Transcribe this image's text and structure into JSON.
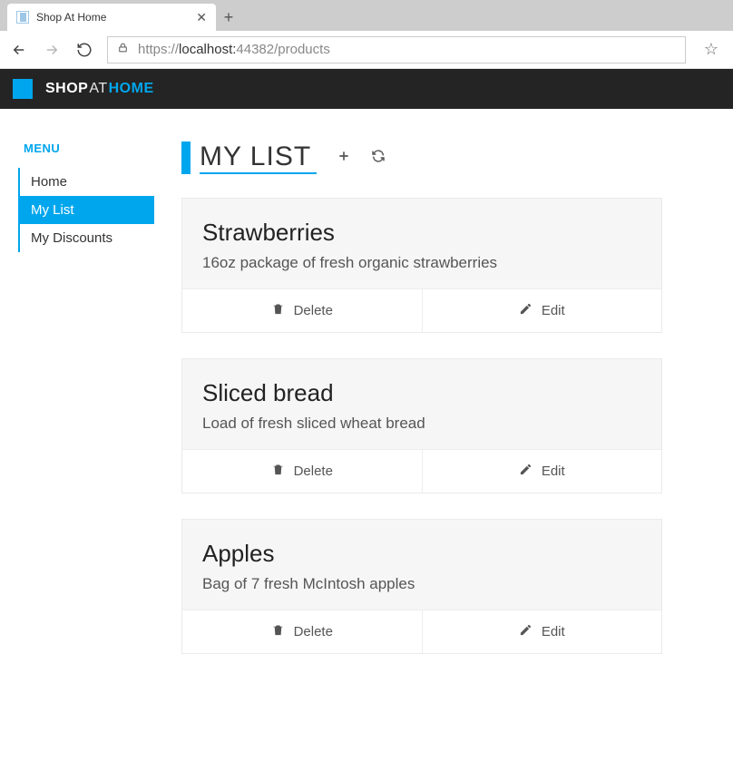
{
  "browser": {
    "tab_title": "Shop At Home",
    "url_prefix": "https://",
    "url_host": "localhost:",
    "url_port_path": "44382/products"
  },
  "brand": {
    "shop": "SHOP",
    "at": "AT",
    "home": "HOME"
  },
  "sidebar": {
    "menu_label": "MENU",
    "items": [
      {
        "label": "Home"
      },
      {
        "label": "My List"
      },
      {
        "label": "My Discounts"
      }
    ]
  },
  "page": {
    "title": "MY LIST"
  },
  "products": [
    {
      "name": "Strawberries",
      "desc": "16oz package of fresh organic strawberries"
    },
    {
      "name": "Sliced bread",
      "desc": "Load of fresh sliced wheat bread"
    },
    {
      "name": "Apples",
      "desc": "Bag of 7 fresh McIntosh apples"
    }
  ],
  "labels": {
    "delete": "Delete",
    "edit": "Edit"
  }
}
